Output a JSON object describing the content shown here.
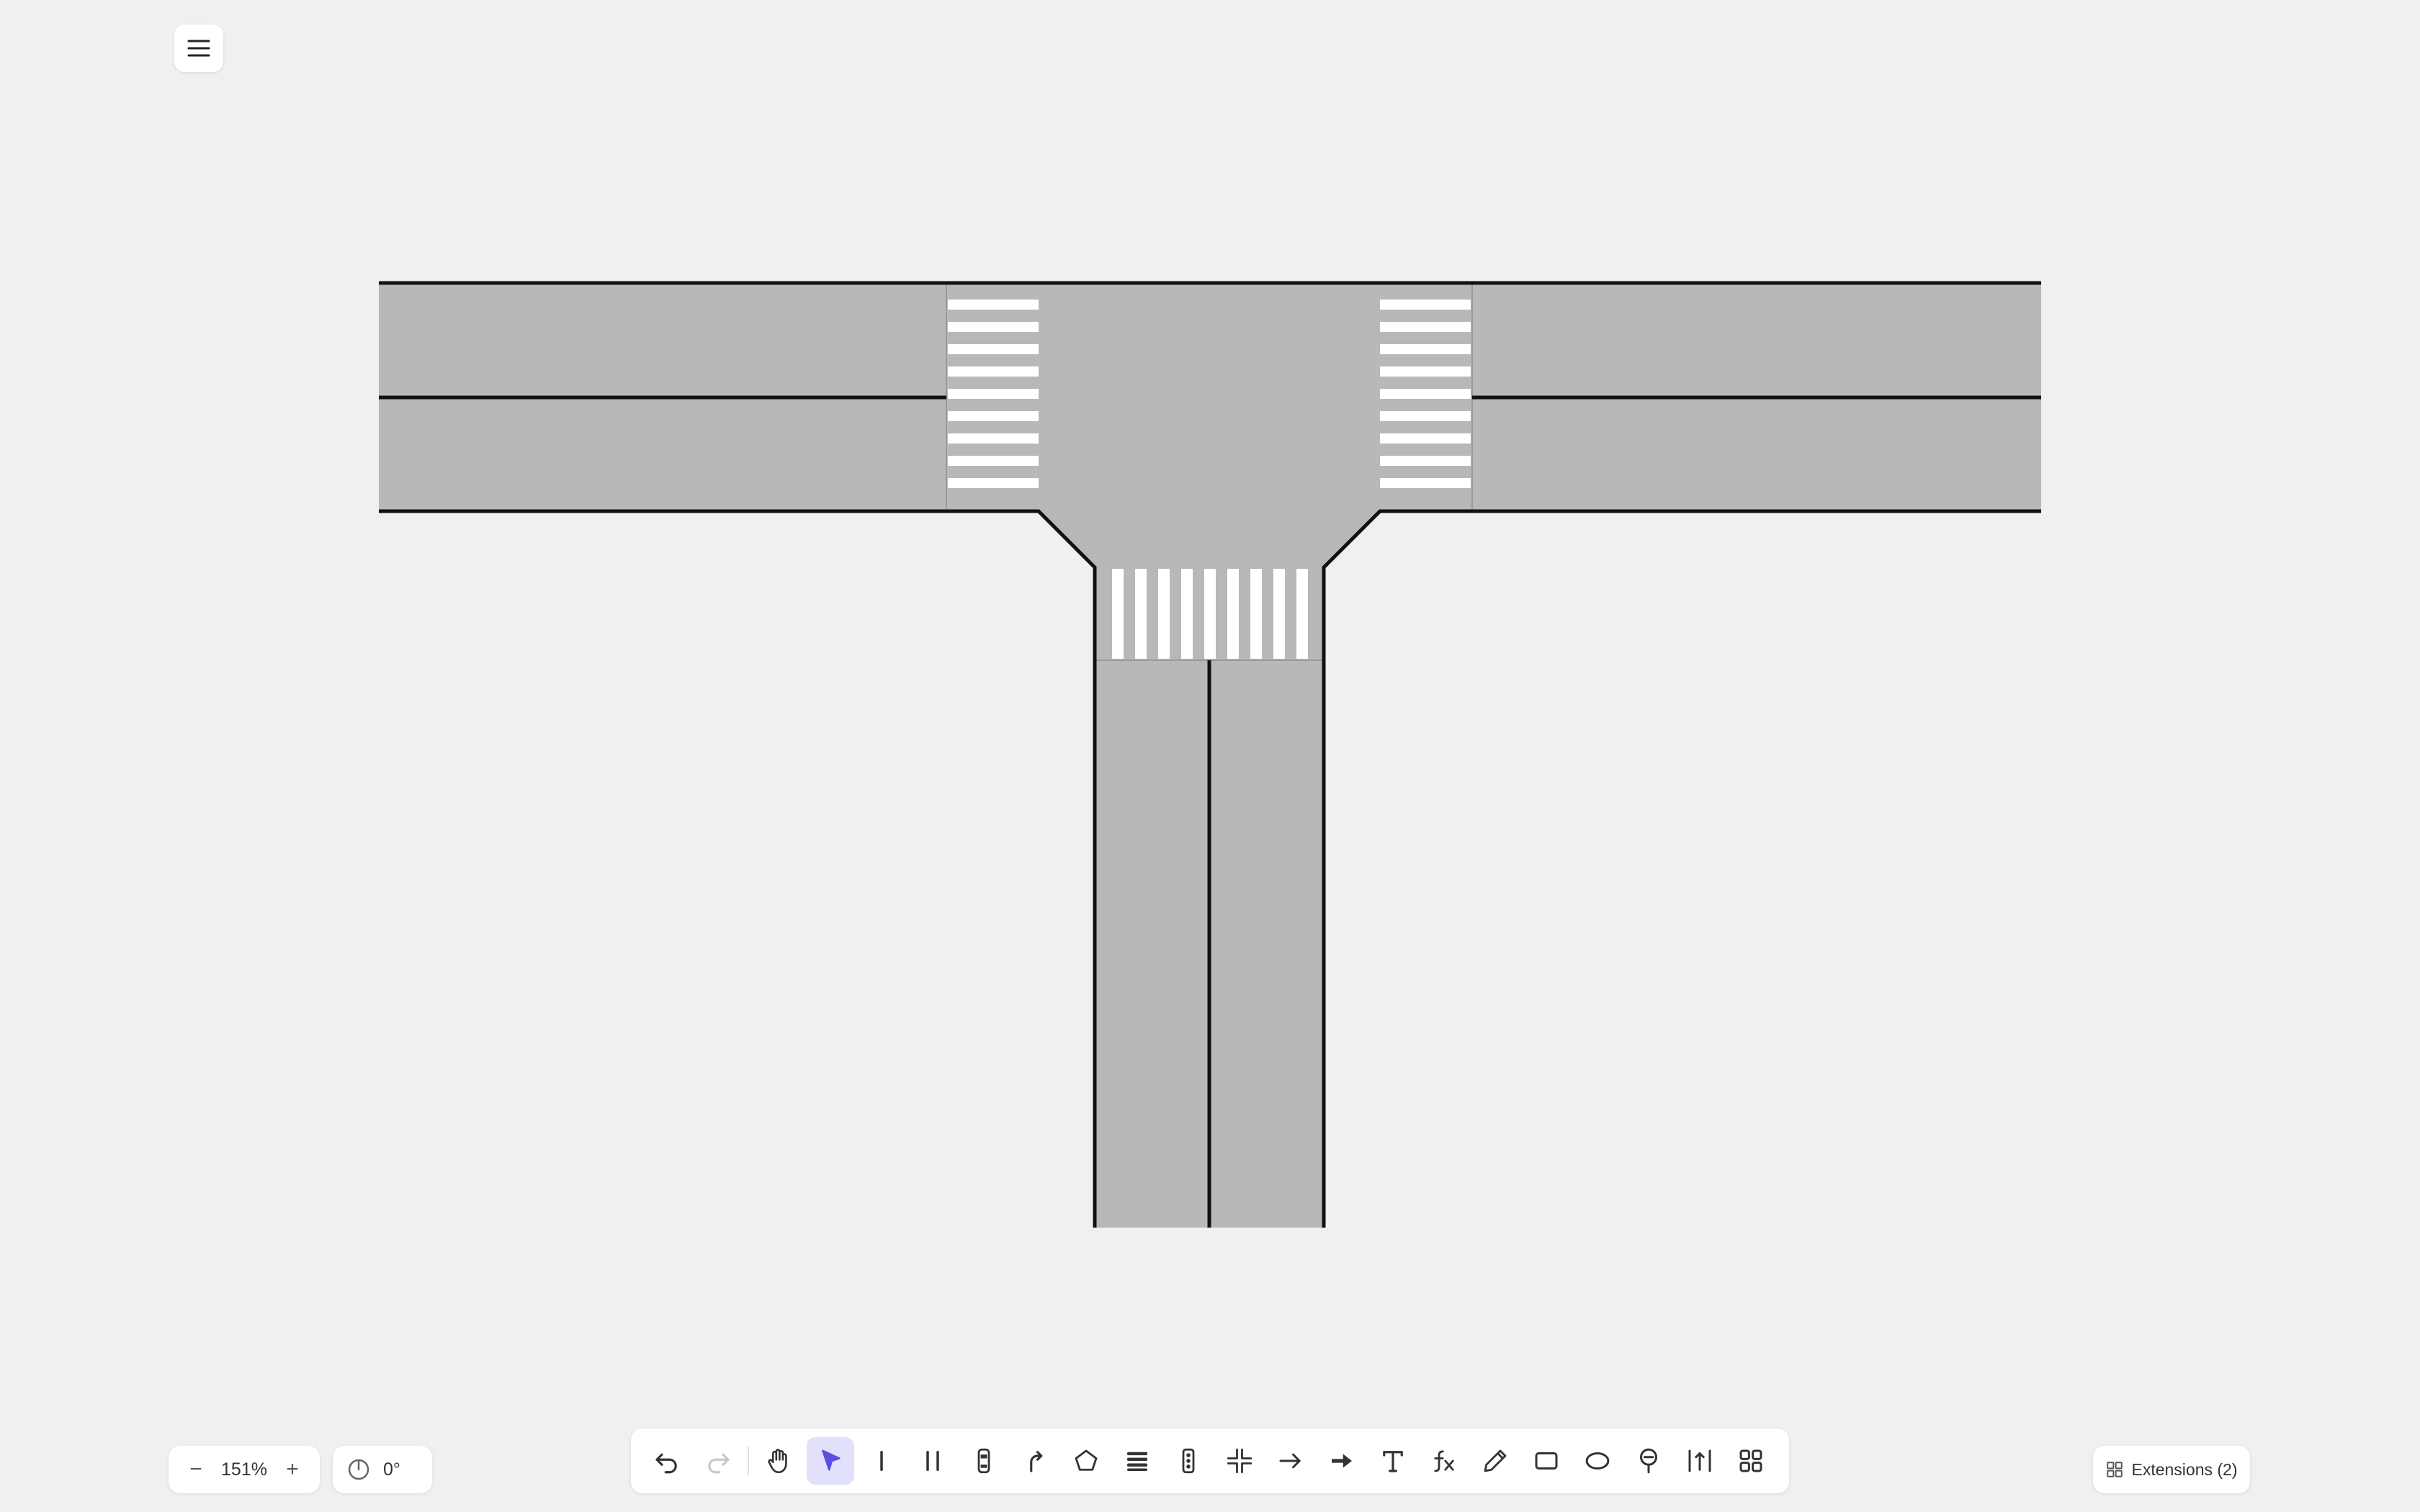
{
  "app": {
    "menu_icon": "hamburger-menu-icon"
  },
  "zoom": {
    "out_label": "−",
    "in_label": "+",
    "value": "151%"
  },
  "rotation": {
    "icon": "compass-icon",
    "value": "0°"
  },
  "toolbar": {
    "active_tool": "select",
    "tools": [
      {
        "id": "undo",
        "icon": "undo-icon",
        "enabled": true
      },
      {
        "id": "redo",
        "icon": "redo-icon",
        "enabled": false
      },
      {
        "id": "hand",
        "icon": "hand-pan-icon",
        "enabled": true
      },
      {
        "id": "select",
        "icon": "select-arrow-icon",
        "enabled": true
      },
      {
        "id": "single-line",
        "icon": "single-line-icon",
        "enabled": true
      },
      {
        "id": "double-line",
        "icon": "double-line-icon",
        "enabled": true
      },
      {
        "id": "vehicle",
        "icon": "vehicle-icon",
        "enabled": true
      },
      {
        "id": "turn-path",
        "icon": "turn-path-icon",
        "enabled": true
      },
      {
        "id": "polygon",
        "icon": "polygon-icon",
        "enabled": true
      },
      {
        "id": "crosswalk",
        "icon": "crosswalk-icon",
        "enabled": true
      },
      {
        "id": "traffic-light",
        "icon": "traffic-light-icon",
        "enabled": true
      },
      {
        "id": "intersection",
        "icon": "intersection-icon",
        "enabled": true
      },
      {
        "id": "thin-arrow",
        "icon": "thin-arrow-icon",
        "enabled": true
      },
      {
        "id": "bold-arrow",
        "icon": "bold-arrow-icon",
        "enabled": true
      },
      {
        "id": "text",
        "icon": "text-icon",
        "enabled": true
      },
      {
        "id": "formula",
        "icon": "formula-icon",
        "enabled": true
      },
      {
        "id": "pencil",
        "icon": "pencil-icon",
        "enabled": true
      },
      {
        "id": "rectangle",
        "icon": "rectangle-icon",
        "enabled": true
      },
      {
        "id": "ellipse",
        "icon": "ellipse-icon",
        "enabled": true
      },
      {
        "id": "marker",
        "icon": "marker-icon",
        "enabled": true
      },
      {
        "id": "measure",
        "icon": "measure-icon",
        "enabled": true
      },
      {
        "id": "more",
        "icon": "grid-more-icon",
        "enabled": true
      }
    ]
  },
  "extensions": {
    "icon": "extensions-grid-icon",
    "label": "Extensions (2)"
  },
  "colors": {
    "background": "#f0f0f0",
    "road": "#b8b8b8",
    "road_edge": "#111111",
    "crosswalk": "#ffffff",
    "accent": "#5b4fe0",
    "active_tool_bg": "#e2e1fb"
  }
}
